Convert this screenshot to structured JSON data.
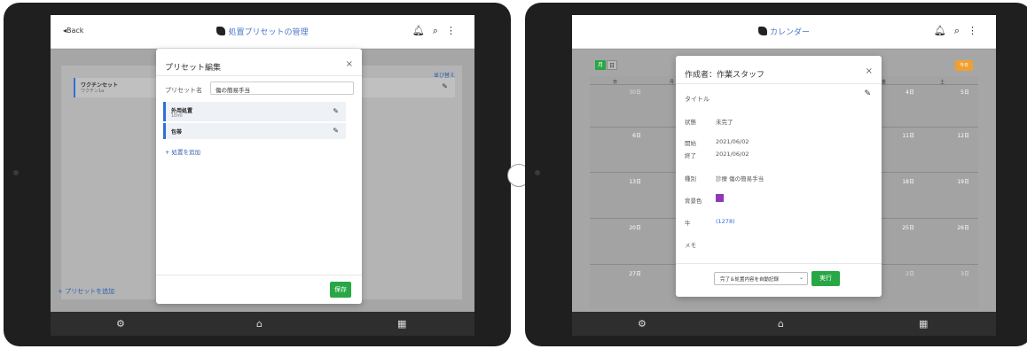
{
  "left": {
    "header": {
      "back_label": "◂Back",
      "title": "処置プリセットの管理"
    },
    "background": {
      "reorder_label": "並び替え",
      "item_title": "ワクチンセット",
      "item_sub": "ワクチン1a",
      "add_preset_label": "+ プリセットを追加"
    },
    "modal": {
      "title": "プリセット編集",
      "close": "×",
      "name_label": "プリセット名",
      "name_value": "傷の簡易手当",
      "items": [
        {
          "title": "外用処置",
          "sub": "10ml"
        },
        {
          "title": "包帯",
          "sub": ""
        }
      ],
      "add_treatment": "+ 処置を追加",
      "save": "保存"
    },
    "footer": {
      "icons": [
        "gear-icon",
        "home-icon",
        "calendar-icon"
      ]
    }
  },
  "right": {
    "header": {
      "title": "カレンダー"
    },
    "calendar": {
      "tabs": [
        "月",
        "日"
      ],
      "today_label": "今日",
      "weekday_first": "日",
      "weekday_second": "月",
      "weekday_fri": "金",
      "weekday_sat": "土",
      "rows": [
        {
          "left": "30日",
          "r1": "4日",
          "r2": "5日"
        },
        {
          "left": "6日",
          "r1": "11日",
          "r2": "12日"
        },
        {
          "left": "13日",
          "r1": "18日",
          "r2": "19日"
        },
        {
          "left": "20日",
          "r1": "25日",
          "r2": "26日"
        },
        {
          "left": "27日",
          "r1": "2日",
          "r2": "3日"
        }
      ]
    },
    "modal": {
      "title": "作成者：作業スタッフ",
      "close": "×",
      "fields": [
        {
          "label": "タイトル",
          "value": ""
        },
        {
          "label": "状態",
          "value": "未完了"
        },
        {
          "label": "開始",
          "value": "2021/06/02"
        },
        {
          "label": "終了",
          "value": "2021/06/02"
        },
        {
          "label": "種別",
          "value": "診療 傷の簡易手当"
        },
        {
          "label": "背景色",
          "value": ""
        },
        {
          "label": "牛",
          "value": "(1278)"
        },
        {
          "label": "メモ",
          "value": ""
        }
      ],
      "bg_color": "#8e3ab8",
      "select_value": "完了＆処置内容を自動記録",
      "run_button": "実行"
    }
  },
  "colors": {
    "accent_blue": "#2f6fd6",
    "success_green": "#28a745",
    "today_orange": "#f0a030"
  }
}
